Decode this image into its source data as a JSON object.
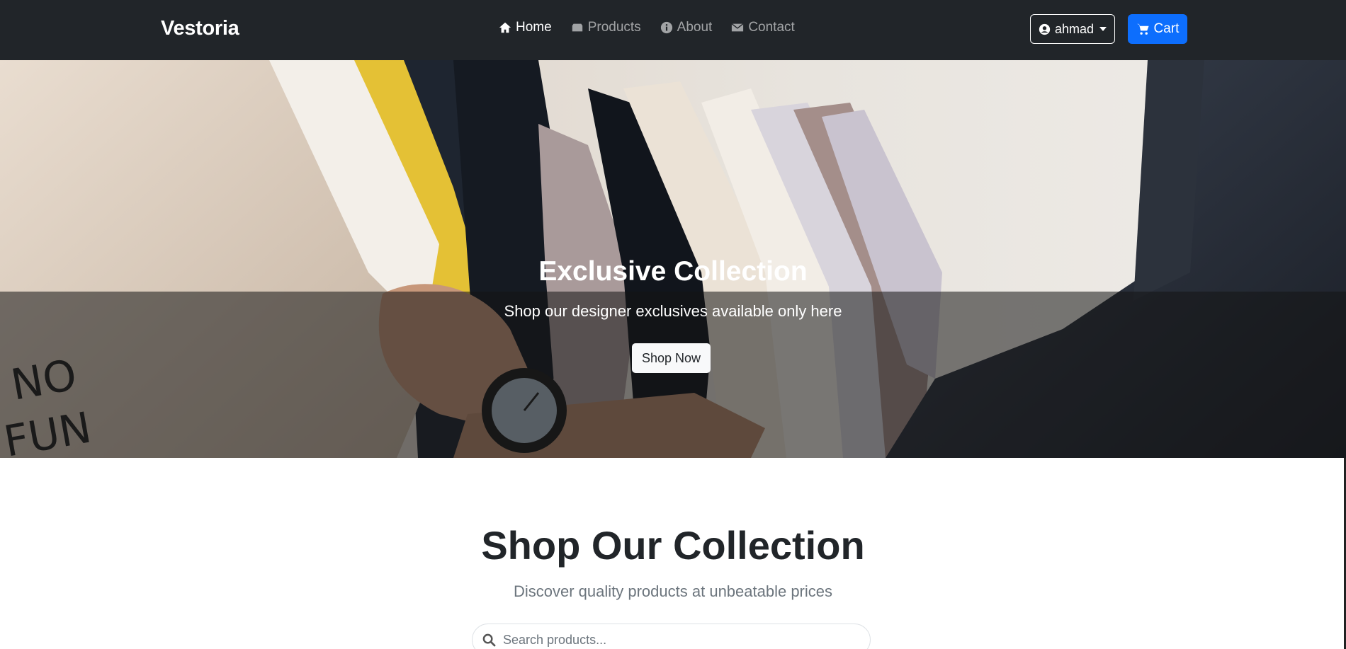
{
  "navbar": {
    "brand": "Vestoria",
    "links": [
      {
        "label": "Home",
        "icon": "home-icon",
        "active": true
      },
      {
        "label": "Products",
        "icon": "products-icon",
        "active": false
      },
      {
        "label": "About",
        "icon": "info-icon",
        "active": false
      },
      {
        "label": "Contact",
        "icon": "envelope-icon",
        "active": false
      }
    ],
    "user_label": "ahmad",
    "cart_label": "Cart"
  },
  "hero": {
    "title": "Exclusive Collection",
    "subtitle": "Shop our designer exclusives available only here",
    "button_label": "Shop Now"
  },
  "collection": {
    "title": "Shop Our Collection",
    "subtitle": "Discover quality products at unbeatable prices",
    "search_placeholder": "Search products..."
  },
  "colors": {
    "navbar_bg": "#212529",
    "primary": "#0d6efd",
    "muted_text": "#6c757d"
  }
}
